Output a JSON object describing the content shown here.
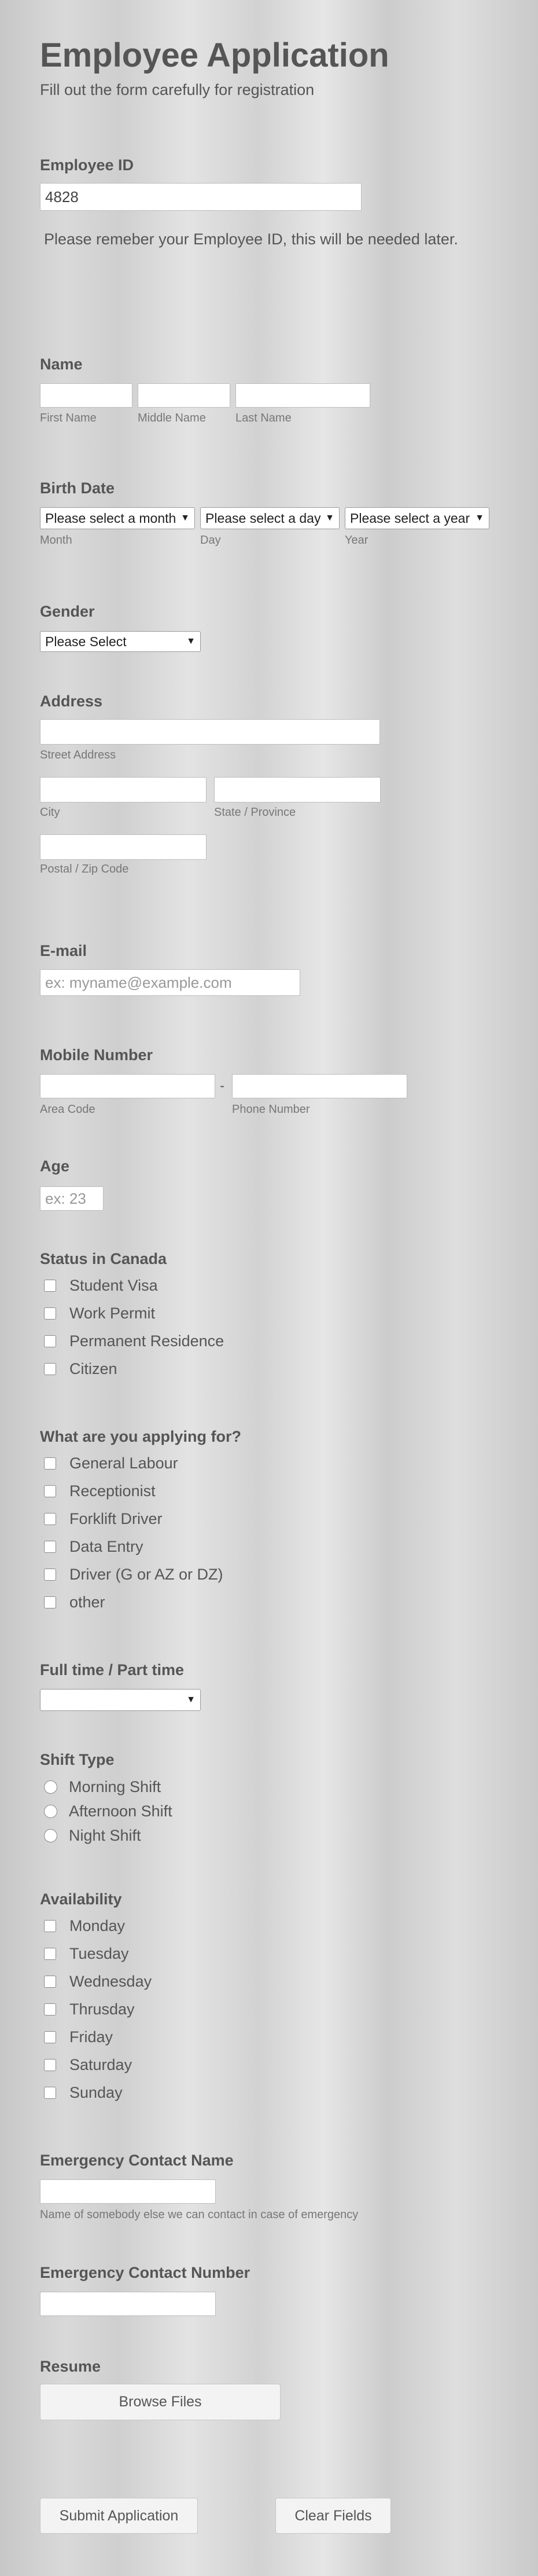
{
  "header": {
    "title": "Employee Application",
    "subtitle": "Fill out the form carefully for registration"
  },
  "employee_id": {
    "label": "Employee ID",
    "value": "4828",
    "note": "Please remeber your Employee ID, this will be needed later."
  },
  "name": {
    "label": "Name",
    "first": "First Name",
    "middle": "Middle Name",
    "last": "Last Name"
  },
  "birth_date": {
    "label": "Birth Date",
    "month_select": "Please select a month",
    "day_select": "Please select a day",
    "year_select": "Please select a year",
    "month": "Month",
    "day": "Day",
    "year": "Year"
  },
  "gender": {
    "label": "Gender",
    "select": "Please Select"
  },
  "address": {
    "label": "Address",
    "street": "Street Address",
    "city": "City",
    "state": "State / Province",
    "postal": "Postal / Zip Code"
  },
  "email": {
    "label": "E-mail",
    "placeholder": "ex: myname@example.com"
  },
  "mobile": {
    "label": "Mobile Number",
    "separator": "-",
    "area_code": "Area Code",
    "phone_number": "Phone Number"
  },
  "age": {
    "label": "Age",
    "placeholder": "ex: 23"
  },
  "status": {
    "label": "Status in Canada",
    "options": [
      "Student Visa",
      "Work Permit",
      "Permanent Residence",
      "Citizen"
    ]
  },
  "applying": {
    "label": "What are you applying for?",
    "options": [
      "General Labour",
      "Receptionist",
      "Forklift Driver",
      "Data Entry",
      "Driver (G or AZ or DZ)",
      "other"
    ]
  },
  "fulltime": {
    "label": "Full time / Part time",
    "select": ""
  },
  "shift": {
    "label": "Shift Type",
    "options": [
      "Morning Shift",
      "Afternoon Shift",
      "Night Shift"
    ]
  },
  "availability": {
    "label": "Availability",
    "options": [
      "Monday",
      "Tuesday",
      "Wednesday",
      "Thrusday",
      "Friday",
      "Saturday",
      "Sunday"
    ]
  },
  "emergency_name": {
    "label": "Emergency Contact Name",
    "sublabel": "Name of somebody else we can contact in case of emergency"
  },
  "emergency_number": {
    "label": "Emergency Contact Number"
  },
  "resume": {
    "label": "Resume",
    "button": "Browse Files"
  },
  "actions": {
    "submit": "Submit Application",
    "clear": "Clear Fields"
  }
}
